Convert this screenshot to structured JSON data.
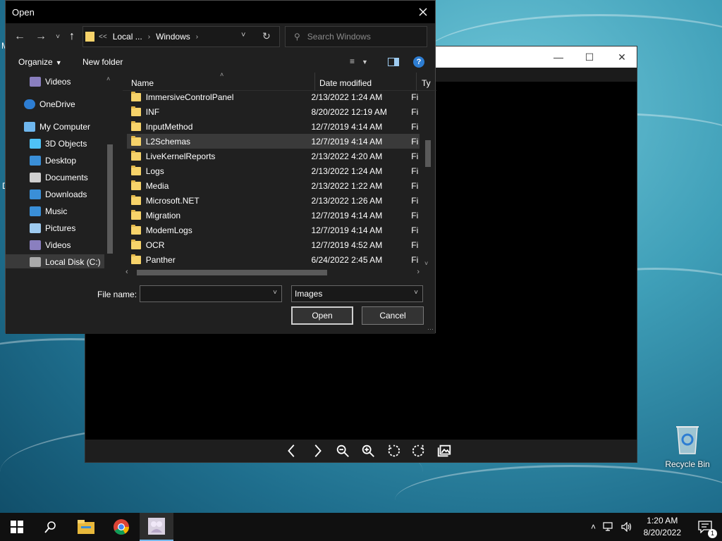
{
  "dialog": {
    "title": "Open",
    "address": {
      "crumb_more": "<<",
      "crumb1": "Local ...",
      "crumb2": "Windows"
    },
    "search_placeholder": "Search Windows",
    "toolbar": {
      "organize": "Organize",
      "new_folder": "New folder"
    },
    "nav_items": [
      {
        "label": "Videos",
        "icon": "videos-icon"
      },
      {
        "label": "OneDrive",
        "icon": "onedrive-icon"
      },
      {
        "label": "My Computer",
        "icon": "computer-icon"
      },
      {
        "label": "3D Objects",
        "icon": "3d-objects-icon"
      },
      {
        "label": "Desktop",
        "icon": "desktop-icon"
      },
      {
        "label": "Documents",
        "icon": "documents-icon"
      },
      {
        "label": "Downloads",
        "icon": "downloads-icon"
      },
      {
        "label": "Music",
        "icon": "music-icon"
      },
      {
        "label": "Pictures",
        "icon": "pictures-icon"
      },
      {
        "label": "Videos",
        "icon": "videos-icon"
      },
      {
        "label": "Local Disk (C:)",
        "icon": "disk-icon"
      }
    ],
    "columns": {
      "name": "Name",
      "date": "Date modified",
      "type": "Ty"
    },
    "files": [
      {
        "name": "ImmersiveControlPanel",
        "date": "2/13/2022 1:24 AM",
        "type": "Fi"
      },
      {
        "name": "INF",
        "date": "8/20/2022 12:19 AM",
        "type": "Fi"
      },
      {
        "name": "InputMethod",
        "date": "12/7/2019 4:14 AM",
        "type": "Fi"
      },
      {
        "name": "L2Schemas",
        "date": "12/7/2019 4:14 AM",
        "type": "Fi"
      },
      {
        "name": "LiveKernelReports",
        "date": "2/13/2022 4:20 AM",
        "type": "Fi"
      },
      {
        "name": "Logs",
        "date": "2/13/2022 1:24 AM",
        "type": "Fi"
      },
      {
        "name": "Media",
        "date": "2/13/2022 1:22 AM",
        "type": "Fi"
      },
      {
        "name": "Microsoft.NET",
        "date": "2/13/2022 1:26 AM",
        "type": "Fi"
      },
      {
        "name": "Migration",
        "date": "12/7/2019 4:14 AM",
        "type": "Fi"
      },
      {
        "name": "ModemLogs",
        "date": "12/7/2019 4:14 AM",
        "type": "Fi"
      },
      {
        "name": "OCR",
        "date": "12/7/2019 4:52 AM",
        "type": "Fi"
      },
      {
        "name": "Panther",
        "date": "6/24/2022 2:45 AM",
        "type": "Fi"
      }
    ],
    "selected_file": "L2Schemas",
    "file_name_label": "File name:",
    "file_name_value": "",
    "file_type_value": "Images",
    "open_label": "Open",
    "cancel_label": "Cancel"
  },
  "desktop": {
    "recycle_bin": "Recycle Bin",
    "edge_letter_top": "M",
    "edge_letter_mid": "D"
  },
  "taskbar": {
    "time": "1:20 AM",
    "date": "8/20/2022",
    "notification_count": "1"
  }
}
